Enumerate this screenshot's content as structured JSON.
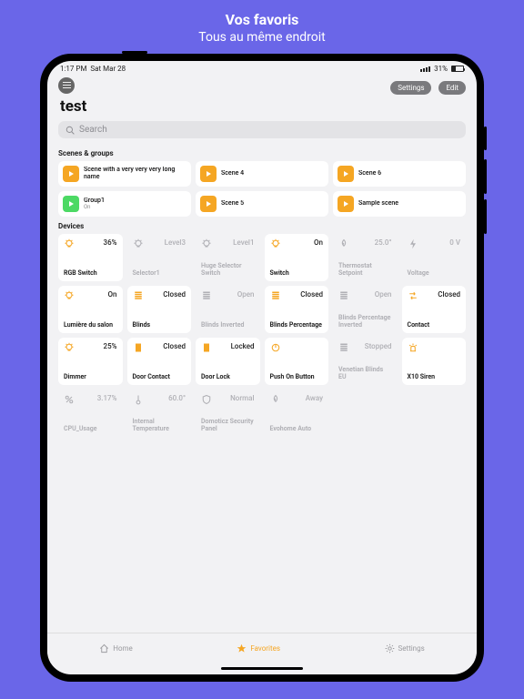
{
  "promo": {
    "title": "Vos favoris",
    "subtitle": "Tous au même endroit"
  },
  "status": {
    "time": "1:17 PM",
    "date": "Sat Mar 28",
    "wifi": "",
    "battery_pct": "31%"
  },
  "topbar": {
    "settings": "Settings",
    "edit": "Edit"
  },
  "page_title": "test",
  "search": {
    "placeholder": "Search"
  },
  "sections": {
    "scenes": "Scenes & groups",
    "devices": "Devices"
  },
  "scenes": [
    {
      "name": "Scene with a very very very long name",
      "sub": "",
      "color": "amber"
    },
    {
      "name": "Scene 4",
      "sub": "",
      "color": "amber"
    },
    {
      "name": "Scene 6",
      "sub": "",
      "color": "amber"
    },
    {
      "name": "Group1",
      "sub": "On",
      "color": "green"
    },
    {
      "name": "Scene 5",
      "sub": "",
      "color": "amber"
    },
    {
      "name": "Sample scene",
      "sub": "",
      "color": "amber"
    }
  ],
  "devices": [
    {
      "name": "RGB Switch",
      "value": "36%",
      "icon": "bulb",
      "active": true
    },
    {
      "name": "Selector1",
      "value": "Level3",
      "icon": "bulb",
      "active": false
    },
    {
      "name": "Huge Selector Switch",
      "value": "Level1",
      "icon": "bulb",
      "active": false
    },
    {
      "name": "Switch",
      "value": "On",
      "icon": "bulb",
      "active": true
    },
    {
      "name": "Thermostat Setpoint",
      "value": "25.0°",
      "icon": "flame",
      "active": false
    },
    {
      "name": "Voltage",
      "value": "0 V",
      "icon": "bolt",
      "active": false
    },
    {
      "name": "Lumière du salon",
      "value": "On",
      "icon": "bulb",
      "active": true
    },
    {
      "name": "Blinds",
      "value": "Closed",
      "icon": "blinds",
      "active": true
    },
    {
      "name": "Blinds Inverted",
      "value": "Open",
      "icon": "blinds",
      "active": false
    },
    {
      "name": "Blinds Percentage",
      "value": "Closed",
      "icon": "blinds",
      "active": true
    },
    {
      "name": "Blinds Percentage Inverted",
      "value": "Open",
      "icon": "blinds",
      "active": false
    },
    {
      "name": "Contact",
      "value": "Closed",
      "icon": "swap",
      "active": true
    },
    {
      "name": "Dimmer",
      "value": "25%",
      "icon": "bulb",
      "active": true
    },
    {
      "name": "Door Contact",
      "value": "Closed",
      "icon": "door",
      "active": true
    },
    {
      "name": "Door Lock",
      "value": "Locked",
      "icon": "door",
      "active": true
    },
    {
      "name": "Push On Button",
      "value": "",
      "icon": "power",
      "active": true
    },
    {
      "name": "Venetian Blinds EU",
      "value": "Stopped",
      "icon": "blinds",
      "active": false
    },
    {
      "name": "X10 Siren",
      "value": "",
      "icon": "siren",
      "active": true
    },
    {
      "name": "CPU_Usage",
      "value": "3.17%",
      "icon": "percent",
      "active": false
    },
    {
      "name": "Internal Temperature",
      "value": "60.0°",
      "icon": "thermo",
      "active": false
    },
    {
      "name": "Domoticz Security Panel",
      "value": "Normal",
      "icon": "shield",
      "active": false
    },
    {
      "name": "Evohome Auto",
      "value": "Away",
      "icon": "flame",
      "active": false
    }
  ],
  "tabs": {
    "home": "Home",
    "favorites": "Favorites",
    "settings": "Settings"
  }
}
